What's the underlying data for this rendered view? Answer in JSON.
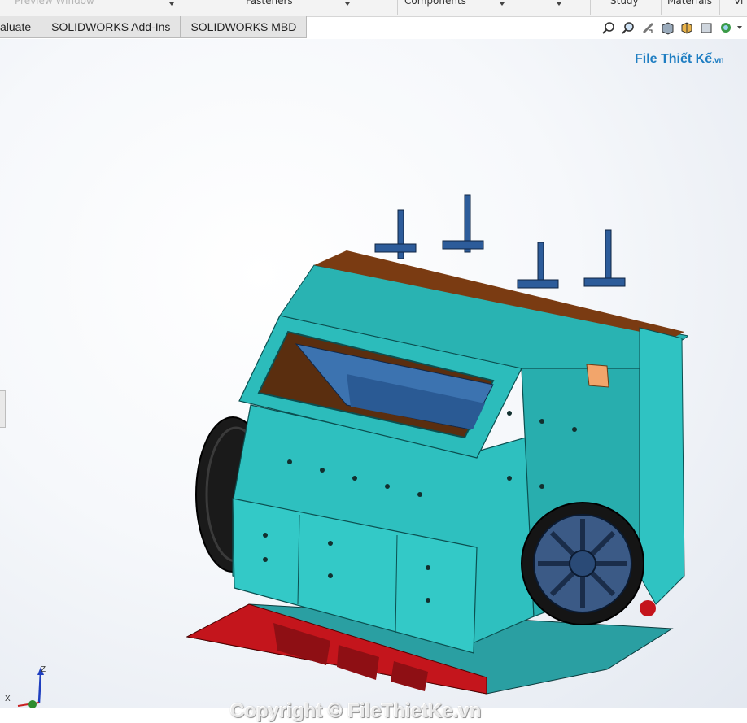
{
  "ribbon": {
    "preview_window": "Preview Window",
    "fasteners": "Fasteners",
    "components": "Components",
    "study": "Study",
    "materials": "Materials",
    "view_partial": "Vi"
  },
  "tabs": [
    {
      "label": "aluate"
    },
    {
      "label": "SOLIDWORKS Add-Ins"
    },
    {
      "label": "SOLIDWORKS MBD"
    }
  ],
  "brand": {
    "main": "File Thiết Kế",
    "suffix": ".vn"
  },
  "watermark": "Copyright © FileThietKe.vn",
  "triad": {
    "z": "Z",
    "x": "X"
  },
  "icons": [
    "zoom-to-fit-icon",
    "zoom-area-icon",
    "previous-view-icon",
    "section-view-icon",
    "view-orientation-icon",
    "display-style-icon",
    "appearance-icon"
  ],
  "colors": {
    "body": "#2ec0bf",
    "liner": "#3c73b0",
    "base": "#c4151c",
    "interior": "#5a2e0f"
  }
}
